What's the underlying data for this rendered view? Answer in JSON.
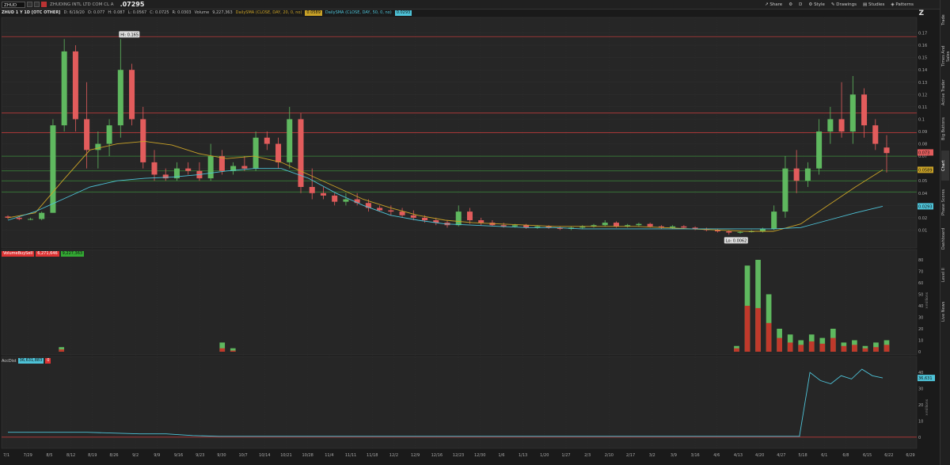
{
  "header": {
    "symbol": "ZHUD",
    "description": "ZHUDING INTL LTD COM CL A",
    "last_price": ".07295"
  },
  "toolbar": {
    "share": "Share",
    "period": "D",
    "style": "Style",
    "drawings": "Drawings",
    "studies": "Studies",
    "patterns": "Patterns"
  },
  "infobar": {
    "title": "ZHUD 1 Y 1D [OTC OTHER]",
    "date": "D: 6/19/20",
    "open": "O: 0.077",
    "high": "H: 0.087",
    "low": "L: 0.0567",
    "close": "C: 0.0725",
    "range": "R: 0.0303",
    "volume_label": "Volume",
    "volume_value": "9,227,363",
    "sma20_label": "DailySMA (CLOSE, DAY, 20, 0, no)",
    "sma20_value": "0.0589",
    "sma50_label": "DailySMA (CLOSE, DAY, 50, 0, no)",
    "sma50_value": "0.0293"
  },
  "volume_panel": {
    "label": "VolumeBuySell",
    "sell_value": "6,271,646",
    "buy_value": "9,227,363",
    "unit": "×millions"
  },
  "accdist_panel": {
    "label": "AccDist",
    "value": "36,631,883",
    "extra": "0",
    "unit": "×millions"
  },
  "sidebar_tabs": [
    "Trade",
    "Times And Sales",
    "Active Trader",
    "Big Buttons",
    "Chart",
    "Phase Scores",
    "Dashboard",
    "Level II",
    "Live News"
  ],
  "active_tab": "Chart",
  "colors": {
    "up": "#5fb85f",
    "down": "#e25c5c",
    "sma20": "#c9a227",
    "sma50": "#4ec3d8",
    "hline_red": "#b83a3a",
    "hline_green": "#3a8a3a"
  },
  "chart_data": [
    {
      "type": "candlestick",
      "price_axis": [
        "0.17",
        "0.16",
        "0.15",
        "0.14",
        "0.13",
        "0.12",
        "0.11",
        "0.1",
        "0.09",
        "0.08",
        "0.07",
        "0.06",
        "0.05",
        "0.04",
        "0.03",
        "0.02",
        "0.01"
      ],
      "ylim": [
        0,
        0.18
      ],
      "x_ticks": [
        "7/1",
        "7/29",
        "8/5",
        "8/12",
        "8/19",
        "8/26",
        "9/2",
        "9/9",
        "9/16",
        "9/23",
        "9/30",
        "10/7",
        "10/14",
        "10/21",
        "10/28",
        "11/4",
        "11/11",
        "11/18",
        "12/2",
        "12/9",
        "12/16",
        "12/23",
        "12/30",
        "1/6",
        "1/13",
        "1/20",
        "1/27",
        "2/3",
        "2/10",
        "2/17",
        "3/2",
        "3/9",
        "3/16",
        "4/6",
        "4/13",
        "4/20",
        "4/27",
        "5/18",
        "6/1",
        "6/8",
        "6/15",
        "6/22",
        "6/29"
      ],
      "hi_label": "Hi: 0.165",
      "lo_label": "Lo: 0.0062",
      "last_label": "0.073",
      "sma20_label": "0.0589",
      "sma50_label": "0.0293",
      "horizontal_lines": [
        {
          "value": 0.167,
          "color": "red"
        },
        {
          "value": 0.105,
          "color": "red"
        },
        {
          "value": 0.089,
          "color": "red"
        },
        {
          "value": 0.07,
          "color": "green"
        },
        {
          "value": 0.058,
          "color": "green"
        },
        {
          "value": 0.05,
          "color": "green"
        },
        {
          "value": 0.041,
          "color": "green"
        }
      ],
      "candles_ohlc": [
        [
          0.021,
          0.022,
          0.019,
          0.02
        ],
        [
          0.02,
          0.021,
          0.018,
          0.019
        ],
        [
          0.019,
          0.02,
          0.018,
          0.019
        ],
        [
          0.019,
          0.025,
          0.018,
          0.024
        ],
        [
          0.024,
          0.1,
          0.024,
          0.095
        ],
        [
          0.095,
          0.165,
          0.09,
          0.155
        ],
        [
          0.155,
          0.16,
          0.09,
          0.1
        ],
        [
          0.1,
          0.13,
          0.06,
          0.075
        ],
        [
          0.075,
          0.09,
          0.06,
          0.08
        ],
        [
          0.08,
          0.1,
          0.07,
          0.095
        ],
        [
          0.095,
          0.165,
          0.085,
          0.14
        ],
        [
          0.14,
          0.145,
          0.095,
          0.1
        ],
        [
          0.1,
          0.11,
          0.06,
          0.065
        ],
        [
          0.065,
          0.075,
          0.05,
          0.055
        ],
        [
          0.055,
          0.06,
          0.05,
          0.052
        ],
        [
          0.052,
          0.065,
          0.05,
          0.06
        ],
        [
          0.06,
          0.065,
          0.055,
          0.058
        ],
        [
          0.058,
          0.065,
          0.05,
          0.052
        ],
        [
          0.052,
          0.08,
          0.05,
          0.07
        ],
        [
          0.07,
          0.075,
          0.055,
          0.058
        ],
        [
          0.058,
          0.065,
          0.055,
          0.062
        ],
        [
          0.062,
          0.07,
          0.058,
          0.06
        ],
        [
          0.06,
          0.09,
          0.058,
          0.085
        ],
        [
          0.085,
          0.09,
          0.075,
          0.08
        ],
        [
          0.08,
          0.085,
          0.06,
          0.065
        ],
        [
          0.065,
          0.11,
          0.06,
          0.1
        ],
        [
          0.1,
          0.105,
          0.04,
          0.045
        ],
        [
          0.045,
          0.06,
          0.035,
          0.04
        ],
        [
          0.04,
          0.045,
          0.035,
          0.038
        ],
        [
          0.038,
          0.04,
          0.03,
          0.033
        ],
        [
          0.033,
          0.04,
          0.03,
          0.035
        ],
        [
          0.035,
          0.04,
          0.03,
          0.032
        ],
        [
          0.032,
          0.035,
          0.025,
          0.028
        ],
        [
          0.028,
          0.03,
          0.025,
          0.026
        ],
        [
          0.026,
          0.03,
          0.022,
          0.025
        ],
        [
          0.025,
          0.028,
          0.02,
          0.022
        ],
        [
          0.022,
          0.026,
          0.018,
          0.02
        ],
        [
          0.02,
          0.022,
          0.016,
          0.018
        ],
        [
          0.018,
          0.02,
          0.014,
          0.016
        ],
        [
          0.016,
          0.018,
          0.012,
          0.014
        ],
        [
          0.014,
          0.03,
          0.013,
          0.025
        ],
        [
          0.025,
          0.028,
          0.015,
          0.018
        ],
        [
          0.018,
          0.02,
          0.014,
          0.016
        ],
        [
          0.016,
          0.018,
          0.013,
          0.014
        ],
        [
          0.014,
          0.016,
          0.012,
          0.013
        ],
        [
          0.013,
          0.015,
          0.012,
          0.014
        ],
        [
          0.014,
          0.015,
          0.011,
          0.012
        ],
        [
          0.012,
          0.014,
          0.011,
          0.013
        ],
        [
          0.013,
          0.014,
          0.011,
          0.012
        ],
        [
          0.012,
          0.013,
          0.01,
          0.011
        ],
        [
          0.011,
          0.013,
          0.01,
          0.012
        ],
        [
          0.012,
          0.014,
          0.011,
          0.013
        ],
        [
          0.013,
          0.015,
          0.012,
          0.014
        ],
        [
          0.014,
          0.018,
          0.013,
          0.016
        ],
        [
          0.016,
          0.017,
          0.012,
          0.013
        ],
        [
          0.013,
          0.015,
          0.012,
          0.014
        ],
        [
          0.014,
          0.016,
          0.013,
          0.015
        ],
        [
          0.015,
          0.016,
          0.012,
          0.013
        ],
        [
          0.013,
          0.014,
          0.011,
          0.012
        ],
        [
          0.012,
          0.014,
          0.011,
          0.013
        ],
        [
          0.013,
          0.014,
          0.011,
          0.012
        ],
        [
          0.012,
          0.013,
          0.01,
          0.011
        ],
        [
          0.011,
          0.012,
          0.009,
          0.01
        ],
        [
          0.01,
          0.011,
          0.008,
          0.009
        ],
        [
          0.009,
          0.01,
          0.0062,
          0.008
        ],
        [
          0.008,
          0.009,
          0.007,
          0.0085
        ],
        [
          0.0085,
          0.01,
          0.008,
          0.009
        ],
        [
          0.009,
          0.012,
          0.008,
          0.011
        ],
        [
          0.011,
          0.03,
          0.01,
          0.025
        ],
        [
          0.025,
          0.07,
          0.02,
          0.06
        ],
        [
          0.06,
          0.075,
          0.04,
          0.05
        ],
        [
          0.05,
          0.065,
          0.045,
          0.06
        ],
        [
          0.06,
          0.1,
          0.055,
          0.09
        ],
        [
          0.09,
          0.11,
          0.08,
          0.1
        ],
        [
          0.1,
          0.13,
          0.085,
          0.09
        ],
        [
          0.09,
          0.135,
          0.08,
          0.12
        ],
        [
          0.12,
          0.125,
          0.085,
          0.095
        ],
        [
          0.095,
          0.1,
          0.075,
          0.08
        ],
        [
          0.077,
          0.087,
          0.0567,
          0.0725
        ]
      ],
      "sma20": [
        0.02,
        0.024,
        0.05,
        0.075,
        0.08,
        0.082,
        0.079,
        0.072,
        0.068,
        0.07,
        0.065,
        0.055,
        0.045,
        0.035,
        0.028,
        0.022,
        0.018,
        0.016,
        0.015,
        0.014,
        0.013,
        0.013,
        0.013,
        0.013,
        0.012,
        0.011,
        0.01,
        0.009,
        0.009,
        0.015,
        0.03,
        0.045,
        0.0589
      ],
      "sma50": [
        0.018,
        0.025,
        0.035,
        0.045,
        0.05,
        0.052,
        0.053,
        0.055,
        0.058,
        0.06,
        0.06,
        0.052,
        0.04,
        0.03,
        0.022,
        0.018,
        0.015,
        0.014,
        0.013,
        0.012,
        0.012,
        0.011,
        0.011,
        0.011,
        0.011,
        0.011,
        0.011,
        0.011,
        0.011,
        0.012,
        0.018,
        0.024,
        0.0293
      ]
    },
    {
      "type": "bar",
      "title": "VolumeBuySell",
      "ylim": [
        0,
        80
      ],
      "y_ticks": [
        "80",
        "70",
        "60",
        "50",
        "40",
        "30",
        "20",
        "10",
        "0"
      ],
      "buy_values": [
        0,
        0,
        0,
        0,
        0,
        4,
        0,
        0,
        0,
        0,
        0,
        0,
        0,
        0,
        0,
        0,
        0,
        0,
        0,
        0,
        8,
        3,
        0,
        0,
        0,
        0,
        0,
        0,
        0,
        0,
        0,
        0,
        0,
        0,
        0,
        0,
        0,
        0,
        0,
        0,
        0,
        0,
        0,
        0,
        0,
        0,
        0,
        0,
        0,
        0,
        0,
        0,
        0,
        0,
        0,
        0,
        0,
        0,
        0,
        0,
        0,
        0,
        0,
        0,
        0,
        0,
        0,
        0,
        5,
        75,
        80,
        50,
        20,
        15,
        10,
        15,
        12,
        20,
        8,
        10,
        5,
        8,
        10
      ],
      "sell_values": [
        0,
        0,
        0,
        0,
        0,
        2,
        0,
        0,
        0,
        0,
        0,
        0,
        0,
        0,
        0,
        0,
        0,
        0,
        0,
        0,
        3,
        1,
        0,
        0,
        0,
        0,
        0,
        0,
        0,
        0,
        0,
        0,
        0,
        0,
        0,
        0,
        0,
        0,
        0,
        0,
        0,
        0,
        0,
        0,
        0,
        0,
        0,
        0,
        0,
        0,
        0,
        0,
        0,
        0,
        0,
        0,
        0,
        0,
        0,
        0,
        0,
        0,
        0,
        0,
        0,
        0,
        0,
        0,
        3,
        40,
        38,
        25,
        12,
        8,
        6,
        9,
        7,
        12,
        5,
        6,
        3,
        4,
        6
      ]
    },
    {
      "type": "line",
      "title": "AccDist",
      "ylim": [
        -5,
        45
      ],
      "y_ticks": [
        "40",
        "30",
        "20",
        "10",
        "0"
      ],
      "values": [
        3,
        3,
        3,
        3,
        2.5,
        2,
        2,
        1,
        0.5,
        0.5,
        0.5,
        0.5,
        0.5,
        0.5,
        0.5,
        0.5,
        0.5,
        0.5,
        0.5,
        0.5,
        0.5,
        0.5,
        0.5,
        0.5,
        0.5,
        0.5,
        0.5,
        0.5,
        0.5,
        0.5,
        0.5,
        1,
        40,
        35,
        33,
        38,
        36,
        42,
        38,
        36.6
      ]
    }
  ]
}
